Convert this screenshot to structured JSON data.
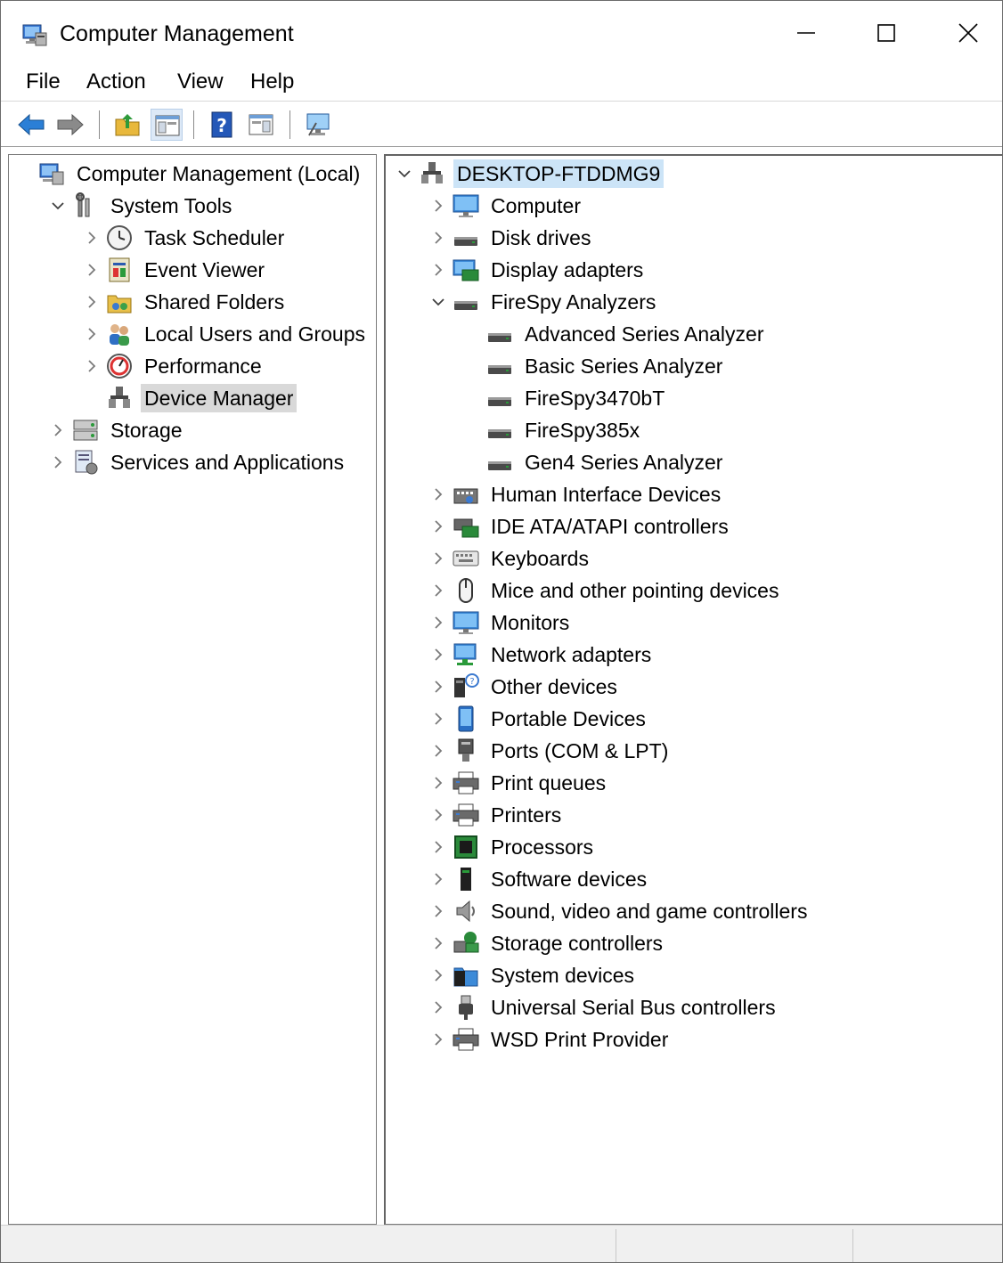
{
  "window": {
    "title": "Computer Management"
  },
  "menu": [
    "File",
    "Action",
    "View",
    "Help"
  ],
  "toolbar": [
    "back-icon",
    "forward-icon",
    "up-folder-icon",
    "show-hide-tree-icon",
    "help-icon",
    "action-pane-icon",
    "connect-computer-icon"
  ],
  "left_tree": [
    {
      "label": "Computer Management (Local)",
      "icon": "computer-management-icon",
      "level": 0,
      "expander": "none"
    },
    {
      "label": "System Tools",
      "icon": "system-tools-icon",
      "level": 1,
      "expander": "expanded"
    },
    {
      "label": "Task Scheduler",
      "icon": "clock-icon",
      "level": 2,
      "expander": "collapsed"
    },
    {
      "label": "Event Viewer",
      "icon": "event-viewer-icon",
      "level": 2,
      "expander": "collapsed"
    },
    {
      "label": "Shared Folders",
      "icon": "shared-folders-icon",
      "level": 2,
      "expander": "collapsed"
    },
    {
      "label": "Local Users and Groups",
      "icon": "users-icon",
      "level": 2,
      "expander": "collapsed"
    },
    {
      "label": "Performance",
      "icon": "performance-icon",
      "level": 2,
      "expander": "collapsed"
    },
    {
      "label": "Device Manager",
      "icon": "device-manager-icon",
      "level": 2,
      "expander": "none",
      "selected": true
    },
    {
      "label": "Storage",
      "icon": "storage-icon",
      "level": 1,
      "expander": "collapsed"
    },
    {
      "label": "Services and Applications",
      "icon": "services-icon",
      "level": 1,
      "expander": "collapsed"
    }
  ],
  "device_tree": [
    {
      "label": "DESKTOP-FTDDMG9",
      "icon": "computer-node-icon",
      "level": 0,
      "expander": "expanded",
      "selected": true
    },
    {
      "label": "Computer",
      "icon": "monitor-icon",
      "level": 1,
      "expander": "collapsed"
    },
    {
      "label": "Disk drives",
      "icon": "drive-icon",
      "level": 1,
      "expander": "collapsed"
    },
    {
      "label": "Display adapters",
      "icon": "display-adapter-icon",
      "level": 1,
      "expander": "collapsed"
    },
    {
      "label": "FireSpy Analyzers",
      "icon": "drive-icon",
      "level": 1,
      "expander": "expanded"
    },
    {
      "label": "Advanced Series Analyzer",
      "icon": "drive-icon",
      "level": 2,
      "expander": "none"
    },
    {
      "label": "Basic Series Analyzer",
      "icon": "drive-icon",
      "level": 2,
      "expander": "none"
    },
    {
      "label": "FireSpy3470bT",
      "icon": "drive-icon",
      "level": 2,
      "expander": "none"
    },
    {
      "label": "FireSpy385x",
      "icon": "drive-icon",
      "level": 2,
      "expander": "none"
    },
    {
      "label": "Gen4 Series Analyzer",
      "icon": "drive-icon",
      "level": 2,
      "expander": "none"
    },
    {
      "label": "Human Interface Devices",
      "icon": "hid-icon",
      "level": 1,
      "expander": "collapsed"
    },
    {
      "label": "IDE ATA/ATAPI controllers",
      "icon": "ide-controller-icon",
      "level": 1,
      "expander": "collapsed"
    },
    {
      "label": "Keyboards",
      "icon": "keyboard-icon",
      "level": 1,
      "expander": "collapsed"
    },
    {
      "label": "Mice and other pointing devices",
      "icon": "mouse-icon",
      "level": 1,
      "expander": "collapsed"
    },
    {
      "label": "Monitors",
      "icon": "monitor-icon",
      "level": 1,
      "expander": "collapsed"
    },
    {
      "label": "Network adapters",
      "icon": "network-icon",
      "level": 1,
      "expander": "collapsed"
    },
    {
      "label": "Other devices",
      "icon": "unknown-device-icon",
      "level": 1,
      "expander": "collapsed"
    },
    {
      "label": "Portable Devices",
      "icon": "portable-device-icon",
      "level": 1,
      "expander": "collapsed"
    },
    {
      "label": "Ports (COM & LPT)",
      "icon": "port-icon",
      "level": 1,
      "expander": "collapsed"
    },
    {
      "label": "Print queues",
      "icon": "printer-icon",
      "level": 1,
      "expander": "collapsed"
    },
    {
      "label": "Printers",
      "icon": "printer-icon",
      "level": 1,
      "expander": "collapsed"
    },
    {
      "label": "Processors",
      "icon": "processor-icon",
      "level": 1,
      "expander": "collapsed"
    },
    {
      "label": "Software devices",
      "icon": "software-device-icon",
      "level": 1,
      "expander": "collapsed"
    },
    {
      "label": "Sound, video and game controllers",
      "icon": "speaker-icon",
      "level": 1,
      "expander": "collapsed"
    },
    {
      "label": "Storage controllers",
      "icon": "storage-controller-icon",
      "level": 1,
      "expander": "collapsed"
    },
    {
      "label": "System devices",
      "icon": "system-devices-icon",
      "level": 1,
      "expander": "collapsed"
    },
    {
      "label": "Universal Serial Bus controllers",
      "icon": "usb-icon",
      "level": 1,
      "expander": "collapsed"
    },
    {
      "label": "WSD Print Provider",
      "icon": "printer-icon",
      "level": 1,
      "expander": "collapsed"
    }
  ]
}
